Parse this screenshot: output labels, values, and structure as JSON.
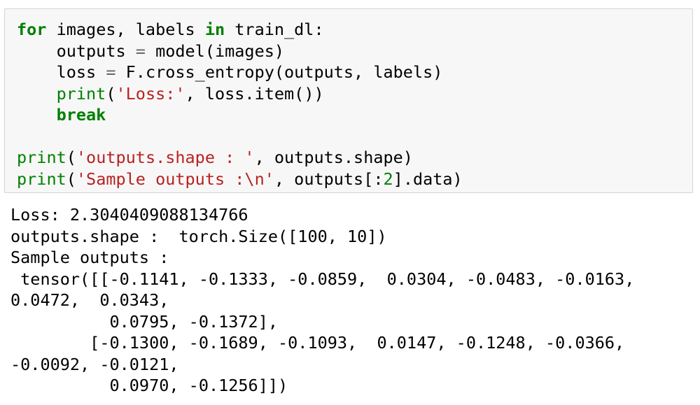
{
  "code": {
    "line1": {
      "kw1": "for",
      "t1": " images, labels ",
      "kw2": "in",
      "t2": " train_dl:"
    },
    "line2": {
      "indent": "    ",
      "t1": "outputs ",
      "op": "=",
      "t2": " model(images)"
    },
    "line3": {
      "indent": "    ",
      "t1": "loss ",
      "op": "=",
      "t2": " F.cross_entropy(outputs, labels)"
    },
    "line4": {
      "indent": "    ",
      "fn": "print",
      "t1": "(",
      "str": "'Loss:'",
      "t2": ", loss.item())"
    },
    "line5": {
      "indent": "    ",
      "kw": "break"
    },
    "line6": {
      "fn": "print",
      "t1": "(",
      "str": "'outputs.shape : '",
      "t2": ", outputs.shape)"
    },
    "line7": {
      "fn": "print",
      "t1": "(",
      "str": "'Sample outputs :\\n'",
      "t2": ", outputs[:",
      "num": "2",
      "t3": "].data)"
    }
  },
  "output": {
    "lines": [
      "Loss: 2.3040409088134766",
      "outputs.shape :  torch.Size([100, 10])",
      "Sample outputs :",
      " tensor([[-0.1141, -0.1333, -0.0859,  0.0304, -0.0483, -0.0163,",
      "0.0472,  0.0343,",
      "          0.0795, -0.1372],",
      "        [-0.1300, -0.1689, -0.1093,  0.0147, -0.1248, -0.0366,",
      "-0.0092, -0.0121,",
      "          0.0970, -0.1256]])"
    ]
  }
}
